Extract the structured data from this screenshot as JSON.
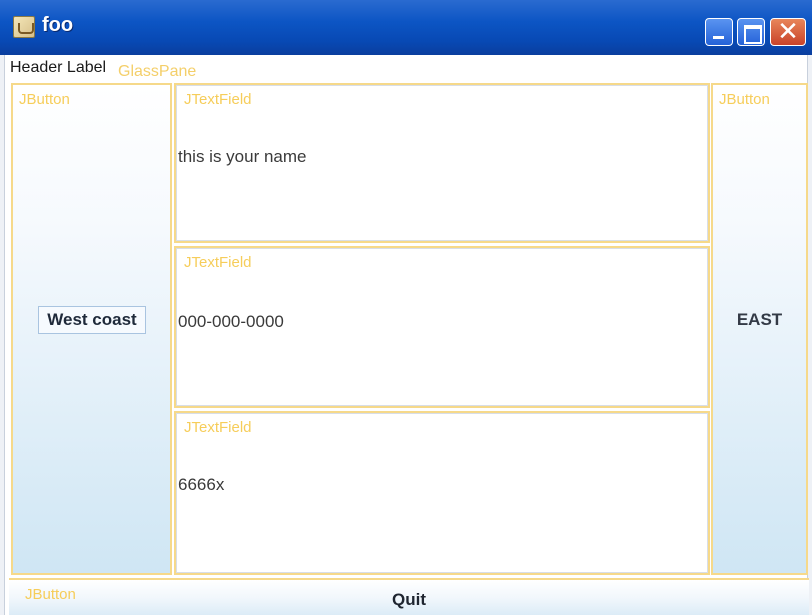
{
  "window": {
    "title": "foo",
    "title_icon": "java-cup-icon",
    "controls": {
      "minimize": "minimize-icon",
      "maximize": "maximize-icon",
      "close": "close-icon",
      "close_glyph": "✕"
    }
  },
  "header": {
    "label": "Header Label",
    "glass_pane_label": "GlassPane"
  },
  "west": {
    "overlay_tag": "JButton",
    "label": "West coast"
  },
  "east": {
    "overlay_tag": "JButton",
    "label": "EAST"
  },
  "fields": [
    {
      "overlay_tag": "JTextField",
      "value": "this is your name"
    },
    {
      "overlay_tag": "JTextField",
      "value": "000-000-0000"
    },
    {
      "overlay_tag": "JTextField",
      "value": "6666x"
    }
  ],
  "south": {
    "overlay_tag": "JButton",
    "label": "Quit"
  },
  "colors": {
    "titlebar": "#0849b4",
    "overlay_text": "#f6cd5a",
    "overlay_border": "#f6d98a"
  }
}
